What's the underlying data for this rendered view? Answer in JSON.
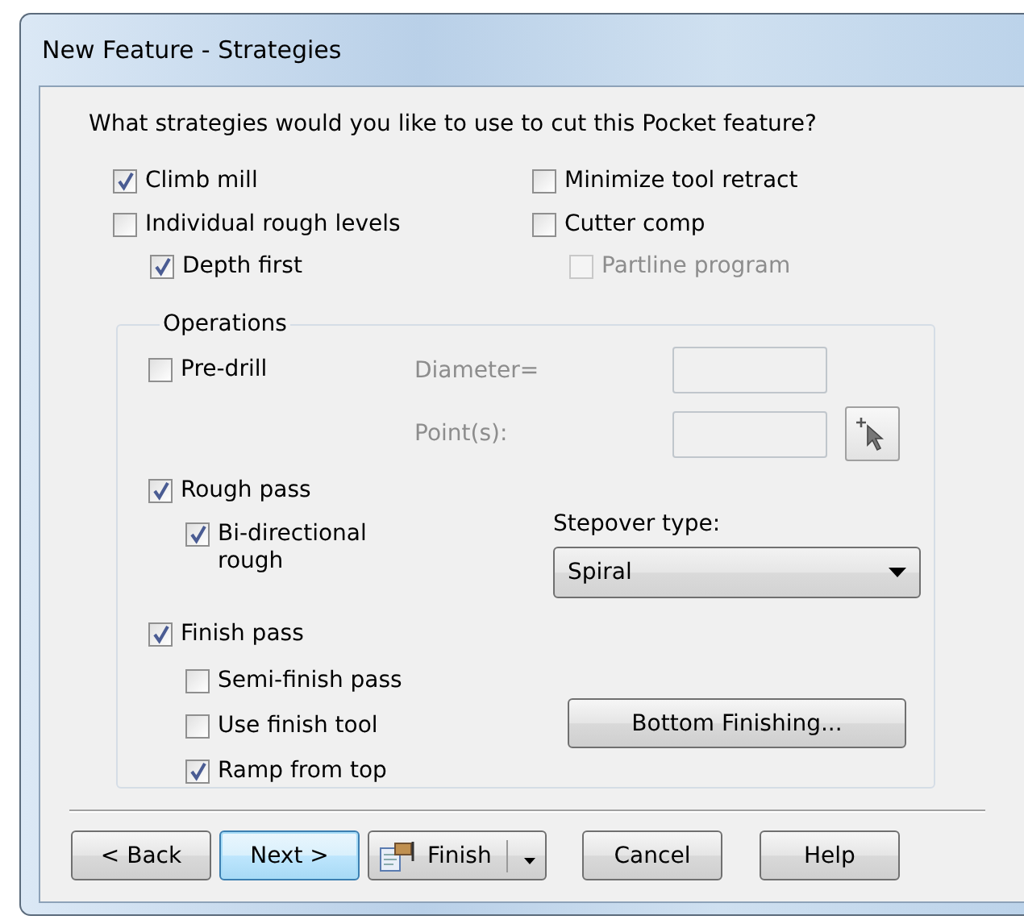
{
  "window": {
    "title": "New Feature - Strategies"
  },
  "prompt": "What strategies would you like to use to cut this Pocket feature?",
  "strategies": {
    "left": [
      {
        "label": "Climb mill",
        "checked": true,
        "disabled": false
      },
      {
        "label": "Individual rough levels",
        "checked": false,
        "disabled": false,
        "children": [
          {
            "label": "Depth first",
            "checked": true,
            "disabled": false
          }
        ]
      }
    ],
    "right": [
      {
        "label": "Minimize tool retract",
        "checked": false,
        "disabled": false
      },
      {
        "label": "Cutter comp",
        "checked": false,
        "disabled": false,
        "children": [
          {
            "label": "Partline program",
            "checked": false,
            "disabled": true
          }
        ]
      }
    ]
  },
  "operations": {
    "legend": "Operations",
    "pre_drill": {
      "label": "Pre-drill",
      "checked": false,
      "disabled": false
    },
    "diameter": {
      "label": "Diameter=",
      "disabled": true
    },
    "points": {
      "label": "Point(s):",
      "disabled": true
    },
    "rough_pass": {
      "label": "Rough pass",
      "checked": true,
      "disabled": false,
      "children": [
        {
          "label": "Bi-directional rough",
          "checked": true,
          "disabled": false
        }
      ]
    },
    "finish_pass": {
      "label": "Finish pass",
      "checked": true,
      "disabled": false,
      "children": [
        {
          "label": "Semi-finish pass",
          "checked": false,
          "disabled": false
        },
        {
          "label": "Use finish tool",
          "checked": false,
          "disabled": false
        },
        {
          "label": "Ramp from top",
          "checked": true,
          "disabled": false
        }
      ]
    },
    "stepover": {
      "label": "Stepover type:",
      "value": "Spiral"
    },
    "bottom_button": "Bottom Finishing..."
  },
  "buttons": [
    {
      "label": "< Back",
      "kind": "plain"
    },
    {
      "label": "Next >",
      "kind": "default"
    },
    {
      "label": "Finish",
      "kind": "split"
    },
    {
      "label": "Cancel",
      "kind": "plain"
    },
    {
      "label": "Help",
      "kind": "plain"
    }
  ]
}
